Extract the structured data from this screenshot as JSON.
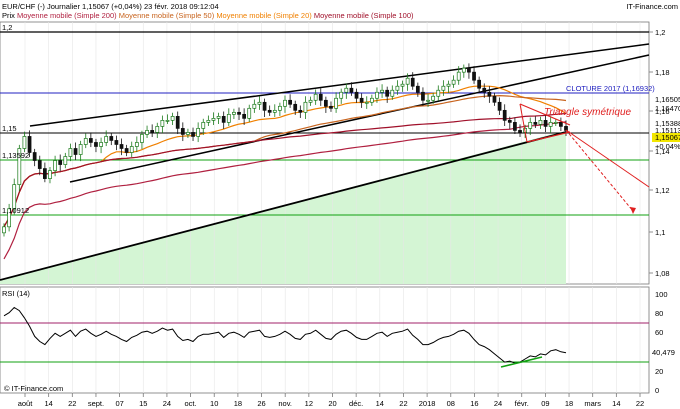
{
  "header": {
    "symbol": "EUR/CHF (-)",
    "period": "Journalier",
    "price_info": "1,15067 (+0,04%)",
    "datetime": "23 févr. 2018 09:12:04",
    "brand": "IT-Finance.com",
    "legend_price": "Prix",
    "legend_ma200": "Moyenne mobile (Simple 200)",
    "legend_ma50": "Moyenne mobile (Simple 50)",
    "legend_ma20": "Moyenne mobile (Simple 20)",
    "legend_ma100": "Moyenne mobile (Simple 100)",
    "watermark": "© IT-Finance.com"
  },
  "colors": {
    "up": "#1a7a1a",
    "down": "#111111",
    "ma20": "#f08000",
    "ma50": "#c8641e",
    "ma100": "#a0102a",
    "ma200": "#b02040",
    "triangle": "#e02020",
    "cloture": "#2020c0",
    "support_green": "#10a010",
    "fill_green": "#d4f5d4",
    "rsi_line": "#000000",
    "rsi_upper": "#a0206a",
    "rsi_lower": "#10a010"
  },
  "chart_data": [
    {
      "type": "candlestick",
      "title": "EUR/CHF (-) Journalier",
      "ylim": [
        1.07,
        1.21
      ],
      "y_ticks": [
        "1,2",
        "1,18",
        "1,16",
        "1,14",
        "1,12",
        "1,1",
        "1,08"
      ],
      "left_labels": [
        "1,2",
        "1,15",
        "1,13592",
        "1,10912"
      ],
      "x_tick_labels": [
        "août",
        "14",
        "22",
        "sept.",
        "07",
        "15",
        "24",
        "oct.",
        "10",
        "18",
        "26",
        "nov.",
        "12",
        "20",
        "déc.",
        "14",
        "22",
        "2018",
        "08",
        "16",
        "24",
        "févr.",
        "09",
        "18",
        "mars",
        "14",
        "22"
      ],
      "price_labels": {
        "ma100": "1,16505",
        "ma50": "1,16470",
        "ma20": "1,15388",
        "close_bar": "1,15113",
        "close": "1,15067",
        "change": "+0,04%"
      },
      "annotations": {
        "cloture": "CLOTURE 2017 (1,16932)",
        "triangle": "Triangle symétrique"
      },
      "levels": {
        "resistance": 1.2,
        "cloture_2017": 1.16932,
        "level_115": 1.15,
        "support_13592": 1.13592,
        "support_10912": 1.10912
      },
      "close_series": [
        1.103,
        1.112,
        1.124,
        1.142,
        1.148,
        1.14,
        1.136,
        1.132,
        1.127,
        1.131,
        1.136,
        1.134,
        1.138,
        1.142,
        1.139,
        1.144,
        1.147,
        1.145,
        1.143,
        1.145,
        1.148,
        1.146,
        1.144,
        1.142,
        1.14,
        1.143,
        1.145,
        1.149,
        1.151,
        1.15,
        1.153,
        1.156,
        1.156,
        1.158,
        1.152,
        1.149,
        1.15,
        1.148,
        1.152,
        1.155,
        1.156,
        1.157,
        1.158,
        1.155,
        1.159,
        1.16,
        1.159,
        1.157,
        1.162,
        1.164,
        1.165,
        1.161,
        1.16,
        1.161,
        1.163,
        1.166,
        1.164,
        1.161,
        1.16,
        1.165,
        1.166,
        1.169,
        1.166,
        1.163,
        1.162,
        1.167,
        1.17,
        1.172,
        1.17,
        1.167,
        1.165,
        1.165,
        1.167,
        1.17,
        1.171,
        1.168,
        1.171,
        1.173,
        1.174,
        1.177,
        1.173,
        1.17,
        1.166,
        1.166,
        1.168,
        1.171,
        1.173,
        1.174,
        1.176,
        1.18,
        1.182,
        1.18,
        1.176,
        1.172,
        1.17,
        1.168,
        1.165,
        1.161,
        1.156,
        1.155,
        1.151,
        1.15,
        1.152,
        1.155,
        1.154,
        1.156,
        1.153,
        1.155,
        1.155,
        1.153,
        1.151
      ],
      "rsi": {
        "label": "RSI (14)",
        "ylim": [
          0,
          100
        ],
        "ticks": [
          "100",
          "80",
          "60",
          "40",
          "20",
          "0"
        ],
        "upper": 70,
        "lower": 30,
        "last_value": "40,479",
        "series": [
          75,
          78,
          83,
          80,
          73,
          65,
          55,
          50,
          47,
          53,
          58,
          55,
          58,
          61,
          55,
          60,
          62,
          58,
          55,
          57,
          60,
          57,
          55,
          52,
          50,
          54,
          56,
          59,
          60,
          58,
          60,
          63,
          61,
          62,
          55,
          51,
          52,
          50,
          55,
          57,
          57,
          58,
          59,
          54,
          58,
          59,
          57,
          54,
          59,
          60,
          61,
          55,
          54,
          55,
          57,
          60,
          57,
          53,
          52,
          57,
          58,
          61,
          57,
          53,
          52,
          57,
          60,
          61,
          58,
          54,
          52,
          52,
          55,
          58,
          59,
          55,
          58,
          59,
          60,
          62,
          56,
          52,
          47,
          47,
          49,
          52,
          54,
          55,
          57,
          60,
          61,
          58,
          52,
          47,
          45,
          42,
          38,
          34,
          30,
          31,
          29,
          30,
          33,
          36,
          35,
          38,
          37,
          41,
          42,
          40,
          39
        ]
      }
    }
  ]
}
